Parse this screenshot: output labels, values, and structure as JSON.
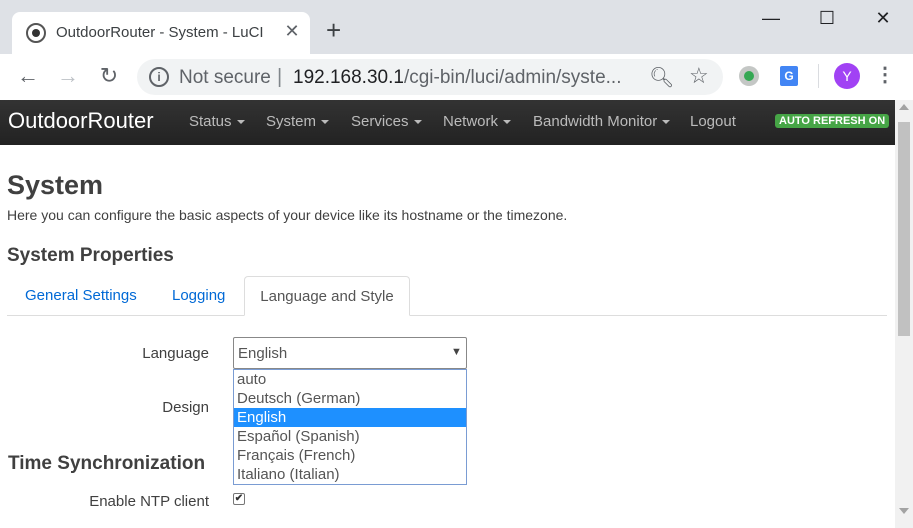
{
  "browser": {
    "tab_title": "OutdoorRouter - System - LuCI",
    "close_glyph": "✕",
    "new_tab_glyph": "+",
    "omnibox": {
      "security_label": "Not secure",
      "separator": "|",
      "url_host": "192.168.30.1",
      "url_path": "/cgi-bin/luci/admin/syste..."
    },
    "avatar_letter": "Y",
    "translate_glyph": "G"
  },
  "navbar": {
    "brand": "OutdoorRouter",
    "menus": [
      "Status",
      "System",
      "Services",
      "Network",
      "Bandwidth Monitor",
      "Logout"
    ],
    "auto_refresh": "AUTO REFRESH ON"
  },
  "page": {
    "title": "System",
    "description": "Here you can configure the basic aspects of your device like its hostname or the timezone.",
    "section_title": "System Properties",
    "tabs": [
      "General Settings",
      "Logging",
      "Language and Style"
    ],
    "active_tab": "Language and Style",
    "language_label": "Language",
    "language_value": "English",
    "language_options": [
      "auto",
      "Deutsch (German)",
      "English",
      "Español (Spanish)",
      "Français (French)",
      "Italiano (Italian)"
    ],
    "selected_option": "English",
    "design_label": "Design",
    "time_sync_title": "Time Synchronization",
    "ntp_label": "Enable NTP client",
    "ntp_checked": true
  },
  "colors": {
    "navbar_bg": "#222222",
    "link": "#0069d6",
    "badge_green": "#46a546",
    "selection": "#1e90ff"
  }
}
